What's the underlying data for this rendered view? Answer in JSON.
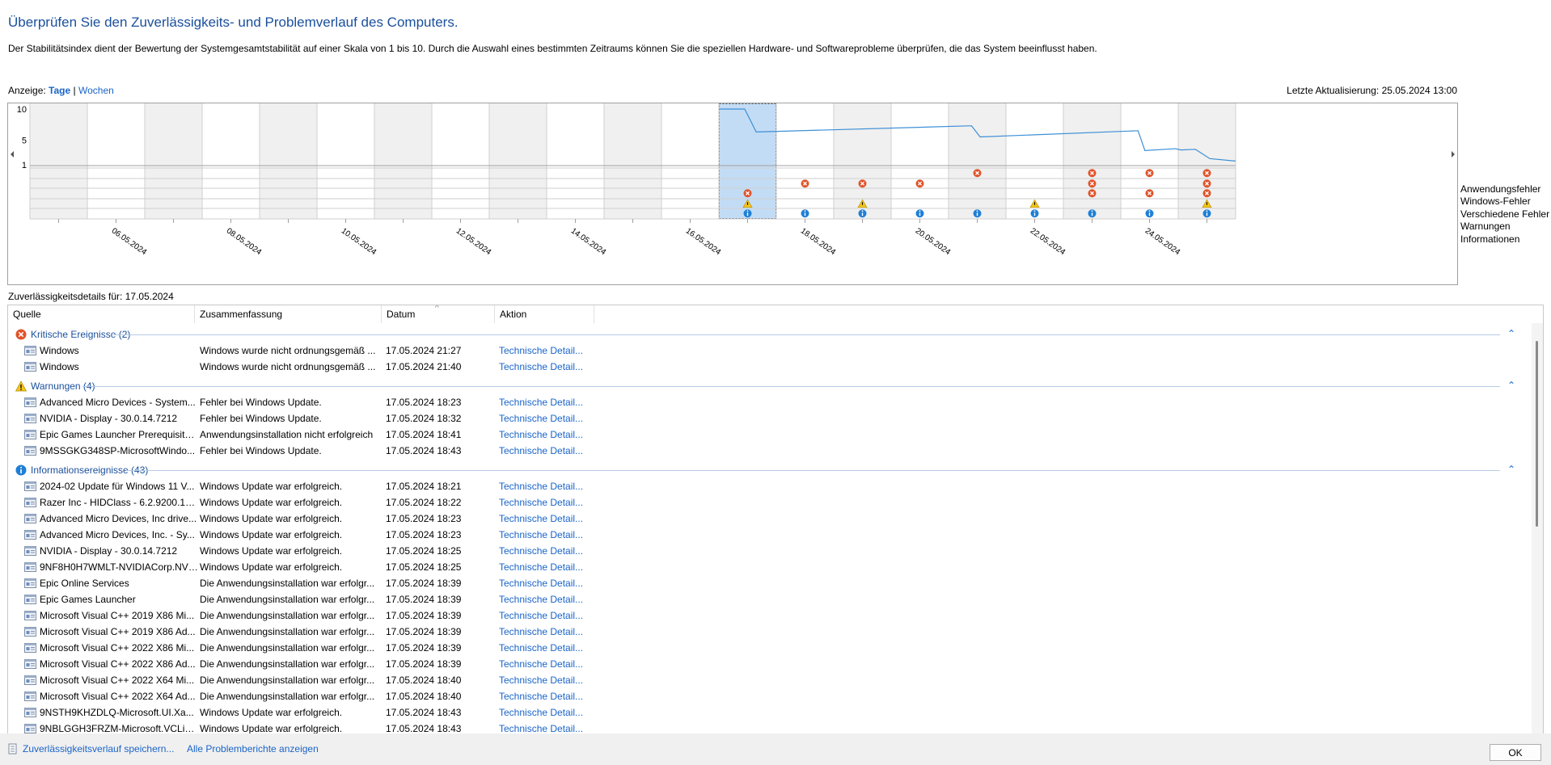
{
  "page": {
    "title": "Überprüfen Sie den Zuverlässigkeits- und Problemverlauf des Computers.",
    "description": "Der Stabilitätsindex dient der Bewertung der Systemgesamtstabilität auf einer Skala von 1 bis 10. Durch die Auswahl eines bestimmten Zeitraums können Sie die speziellen Hardware- und Softwareprobleme überprüfen, die das System beeinflusst haben."
  },
  "view": {
    "label": "Anzeige:",
    "days": "Tage",
    "separator": "|",
    "weeks": "Wochen",
    "last_update": "Letzte Aktualisierung: 25.05.2024 13:00"
  },
  "chart_data": {
    "type": "line",
    "y_ticks": [
      "10",
      "5",
      "1"
    ],
    "ylim": [
      1,
      10
    ],
    "x_labels": [
      "06.05.2024",
      "08.05.2024",
      "10.05.2024",
      "12.05.2024",
      "14.05.2024",
      "16.05.2024",
      "18.05.2024",
      "20.05.2024",
      "22.05.2024",
      "24.05.2024"
    ],
    "days": [
      "05.05.2024",
      "06.05.2024",
      "07.05.2024",
      "08.05.2024",
      "09.05.2024",
      "10.05.2024",
      "11.05.2024",
      "12.05.2024",
      "13.05.2024",
      "14.05.2024",
      "15.05.2024",
      "16.05.2024",
      "17.05.2024",
      "18.05.2024",
      "19.05.2024",
      "20.05.2024",
      "21.05.2024",
      "22.05.2024",
      "23.05.2024",
      "24.05.2024",
      "25.05.2024"
    ],
    "selected_day": "17.05.2024",
    "stability_line": [
      [
        12.0,
        10.0
      ],
      [
        12.45,
        10.0
      ],
      [
        12.65,
        6.3
      ],
      [
        16.4,
        7.3
      ],
      [
        16.55,
        5.5
      ],
      [
        19.3,
        6.5
      ],
      [
        19.42,
        3.3
      ],
      [
        19.95,
        3.6
      ],
      [
        20.05,
        3.4
      ],
      [
        20.3,
        3.5
      ],
      [
        20.55,
        2.0
      ],
      [
        21.0,
        1.6
      ]
    ],
    "rows": [
      "Anwendungsfehler",
      "Windows-Fehler",
      "Verschiedene Fehler",
      "Warnungen",
      "Informationen"
    ],
    "events": {
      "Anwendungsfehler": [
        "21.05.2024",
        "23.05.2024",
        "24.05.2024",
        "25.05.2024"
      ],
      "Windows-Fehler": [
        "18.05.2024",
        "19.05.2024",
        "20.05.2024",
        "23.05.2024",
        "25.05.2024"
      ],
      "Verschiedene Fehler": [
        "17.05.2024",
        "23.05.2024",
        "24.05.2024",
        "25.05.2024"
      ],
      "Warnungen": [
        "17.05.2024",
        "19.05.2024",
        "22.05.2024",
        "25.05.2024"
      ],
      "Informationen": [
        "17.05.2024",
        "18.05.2024",
        "19.05.2024",
        "20.05.2024",
        "21.05.2024",
        "22.05.2024",
        "23.05.2024",
        "24.05.2024",
        "25.05.2024"
      ]
    },
    "colors": {
      "line": "#3c8fd6",
      "selection": "#c3dcf5",
      "shade": "#f0f0f0",
      "error": "#e0542b",
      "warning": "#f5c518",
      "info": "#1e7fd6"
    }
  },
  "details": {
    "label": "Zuverlässigkeitsdetails für: 17.05.2024",
    "columns": [
      "Quelle",
      "Zusammenfassung",
      "Datum",
      "Aktion"
    ],
    "groups": [
      {
        "icon": "error",
        "label": "Kritische Ereignisse (2)",
        "rows": [
          [
            "Windows",
            "Windows wurde nicht ordnungsgemäß ...",
            "17.05.2024 21:27",
            "Technische Detail..."
          ],
          [
            "Windows",
            "Windows wurde nicht ordnungsgemäß ...",
            "17.05.2024 21:40",
            "Technische Detail..."
          ]
        ]
      },
      {
        "icon": "warning",
        "label": "Warnungen (4)",
        "rows": [
          [
            "Advanced Micro Devices - System...",
            "Fehler bei Windows Update.",
            "17.05.2024 18:23",
            "Technische Detail..."
          ],
          [
            "NVIDIA - Display - 30.0.14.7212",
            "Fehler bei Windows Update.",
            "17.05.2024 18:32",
            "Technische Detail..."
          ],
          [
            "Epic Games Launcher Prerequisite...",
            "Anwendungsinstallation nicht erfolgreich",
            "17.05.2024 18:41",
            "Technische Detail..."
          ],
          [
            "9MSSGKG348SP-MicrosoftWindo...",
            "Fehler bei Windows Update.",
            "17.05.2024 18:43",
            "Technische Detail..."
          ]
        ]
      },
      {
        "icon": "info",
        "label": "Informationsereignisse (43)",
        "rows": [
          [
            "2024-02 Update für Windows 11 V...",
            "Windows Update war erfolgreich.",
            "17.05.2024 18:21",
            "Technische Detail..."
          ],
          [
            "Razer Inc - HIDClass - 6.2.9200.165...",
            "Windows Update war erfolgreich.",
            "17.05.2024 18:22",
            "Technische Detail..."
          ],
          [
            "Advanced Micro Devices, Inc drive...",
            "Windows Update war erfolgreich.",
            "17.05.2024 18:23",
            "Technische Detail..."
          ],
          [
            "Advanced Micro Devices, Inc. - Sy...",
            "Windows Update war erfolgreich.",
            "17.05.2024 18:23",
            "Technische Detail..."
          ],
          [
            "NVIDIA - Display - 30.0.14.7212",
            "Windows Update war erfolgreich.",
            "17.05.2024 18:25",
            "Technische Detail..."
          ],
          [
            "9NF8H0H7WMLT-NVIDIACorp.NVI...",
            "Windows Update war erfolgreich.",
            "17.05.2024 18:25",
            "Technische Detail..."
          ],
          [
            "Epic Online Services",
            "Die Anwendungsinstallation war erfolgr...",
            "17.05.2024 18:39",
            "Technische Detail..."
          ],
          [
            "Epic Games Launcher",
            "Die Anwendungsinstallation war erfolgr...",
            "17.05.2024 18:39",
            "Technische Detail..."
          ],
          [
            "Microsoft Visual C++ 2019 X86 Mi...",
            "Die Anwendungsinstallation war erfolgr...",
            "17.05.2024 18:39",
            "Technische Detail..."
          ],
          [
            "Microsoft Visual C++ 2019 X86 Ad...",
            "Die Anwendungsinstallation war erfolgr...",
            "17.05.2024 18:39",
            "Technische Detail..."
          ],
          [
            "Microsoft Visual C++ 2022 X86 Mi...",
            "Die Anwendungsinstallation war erfolgr...",
            "17.05.2024 18:39",
            "Technische Detail..."
          ],
          [
            "Microsoft Visual C++ 2022 X86 Ad...",
            "Die Anwendungsinstallation war erfolgr...",
            "17.05.2024 18:39",
            "Technische Detail..."
          ],
          [
            "Microsoft Visual C++ 2022 X64 Mi...",
            "Die Anwendungsinstallation war erfolgr...",
            "17.05.2024 18:40",
            "Technische Detail..."
          ],
          [
            "Microsoft Visual C++ 2022 X64 Ad...",
            "Die Anwendungsinstallation war erfolgr...",
            "17.05.2024 18:40",
            "Technische Detail..."
          ],
          [
            "9NSTH9KHZDLQ-Microsoft.UI.Xa...",
            "Windows Update war erfolgreich.",
            "17.05.2024 18:43",
            "Technische Detail..."
          ],
          [
            "9NBLGGH3FRZM-Microsoft.VCLib...",
            "Windows Update war erfolgreich.",
            "17.05.2024 18:43",
            "Technische Detail..."
          ]
        ]
      }
    ]
  },
  "footer": {
    "save_link": "Zuverlässigkeitsverlauf speichern...",
    "all_reports_link": "Alle Problemberichte anzeigen",
    "ok_button": "OK"
  }
}
